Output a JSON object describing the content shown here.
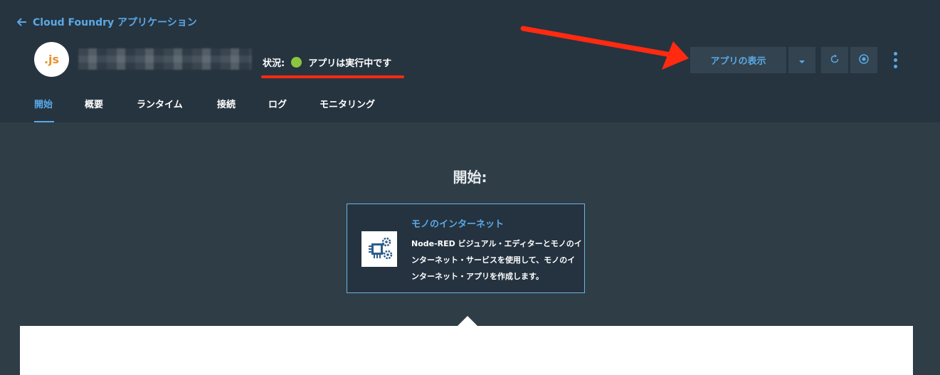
{
  "header": {
    "back_label": "Cloud Foundry アプリケーション",
    "app_logo_text": ".js",
    "status_label": "状況:",
    "status_text": "アプリは実行中です",
    "status_color": "#8cc63f",
    "view_app_label": "アプリの表示",
    "icons": {
      "back": "arrow-left-icon",
      "caret": "chevron-down-icon",
      "restart": "restart-icon",
      "stop": "stop-icon",
      "more": "more-vertical-icon"
    }
  },
  "tabs": [
    {
      "label": "開始",
      "active": true
    },
    {
      "label": "概要",
      "active": false
    },
    {
      "label": "ランタイム",
      "active": false
    },
    {
      "label": "接続",
      "active": false
    },
    {
      "label": "ログ",
      "active": false
    },
    {
      "label": "モニタリング",
      "active": false
    }
  ],
  "main": {
    "section_title": "開始:",
    "card": {
      "title": "モノのインターネット",
      "description": "Node-RED ビジュアル・エディターとモノのインターネット・サービスを使用して、モノのインターネット・アプリを作成します。",
      "icon": "iot-chip-gear-icon"
    }
  },
  "colors": {
    "accent": "#5aa9e6",
    "header_bg": "#263440",
    "body_bg": "#2f3d47",
    "annotation": "#ff2a10"
  }
}
